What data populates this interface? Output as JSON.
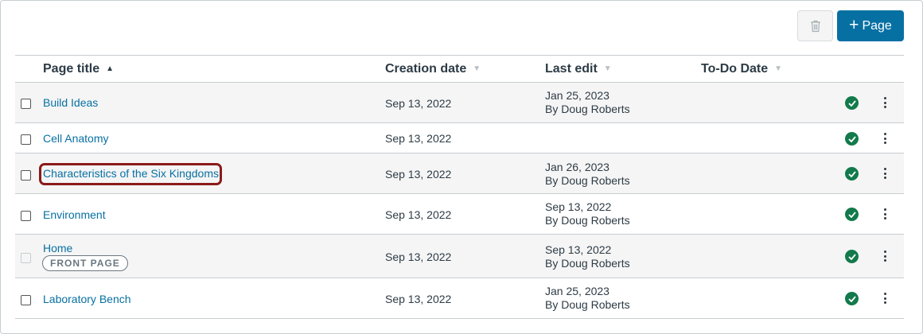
{
  "toolbar": {
    "delete_icon": "trash-icon",
    "add_label": "Page",
    "add_icon": "plus-icon",
    "accent": "#0770a3"
  },
  "table": {
    "columns": [
      {
        "label": "Page title",
        "sort": "ascending"
      },
      {
        "label": "Creation date",
        "sort": "none"
      },
      {
        "label": "Last edit",
        "sort": "none"
      },
      {
        "label": "To-Do Date",
        "sort": "none"
      }
    ],
    "rows": [
      {
        "title": "Build Ideas",
        "created": "Sep 13, 2022",
        "edit_date": "Jan 25, 2023",
        "edit_by": "By Doug Roberts",
        "published": true
      },
      {
        "title": "Cell Anatomy",
        "created": "Sep 13, 2022",
        "edit_date": "",
        "edit_by": "",
        "published": true
      },
      {
        "title": "Characteristics of the Six Kingdoms",
        "created": "Sep 13, 2022",
        "edit_date": "Jan 26, 2023",
        "edit_by": "By Doug Roberts",
        "published": true,
        "highlighted": true
      },
      {
        "title": "Environment",
        "created": "Sep 13, 2022",
        "edit_date": "Sep 13, 2022",
        "edit_by": "By Doug Roberts",
        "published": true
      },
      {
        "title": "Home",
        "badge": "FRONT PAGE",
        "created": "Sep 13, 2022",
        "edit_date": "Sep 13, 2022",
        "edit_by": "By Doug Roberts",
        "published": true
      },
      {
        "title": "Laboratory Bench",
        "created": "Sep 13, 2022",
        "edit_date": "Jan 25, 2023",
        "edit_by": "By Doug Roberts",
        "published": true
      }
    ]
  },
  "colors": {
    "link": "#0770a3",
    "published": "#127a4b",
    "highlight_border": "#8b1a1a"
  }
}
